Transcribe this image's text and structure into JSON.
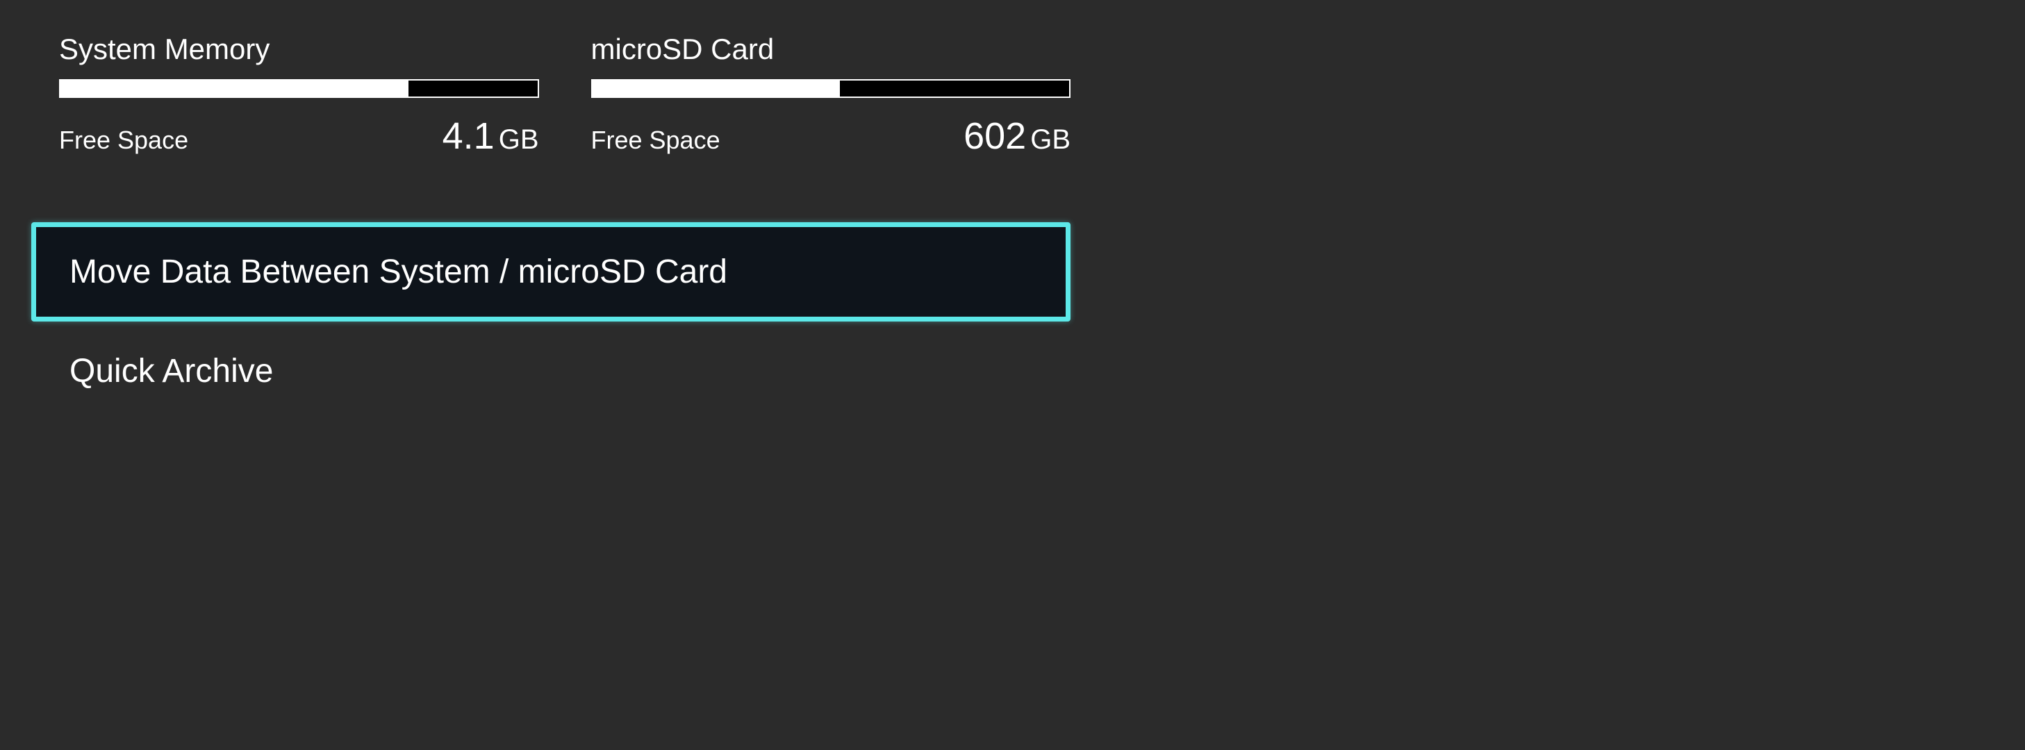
{
  "storage": [
    {
      "title": "System Memory",
      "fill_percent": 73,
      "free_label": "Free Space",
      "free_value": "4.1",
      "free_unit": "GB"
    },
    {
      "title": "microSD Card",
      "fill_percent": 52,
      "free_label": "Free Space",
      "free_value": "602",
      "free_unit": "GB"
    }
  ],
  "menu": {
    "items": [
      {
        "label": "Move Data Between System / microSD Card",
        "selected": true
      },
      {
        "label": "Quick Archive",
        "selected": false
      }
    ]
  }
}
